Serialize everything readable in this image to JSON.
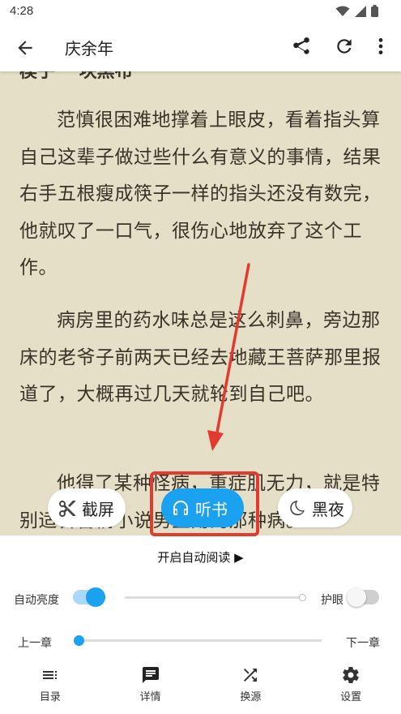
{
  "status": {
    "time": "4:28"
  },
  "appbar": {
    "title": "庆余年"
  },
  "reader": {
    "chapter_fragment": "楔子 一块黑布",
    "paragraphs": [
      "范慎很困难地撑着上眼皮，看着指头算自己这辈子做过些什么有意义的事情，结果右手五根瘦成筷子一样的指头还没有数完，他就叹了一口气，很伤心地放弃了这个工作。",
      "病房里的药水味总是这么刺鼻，旁边那床的老爷子前两天已经去地藏王菩萨那里报道了，大概再过几天就轮到自己吧。",
      "他得了某种怪病，重症肌无力，就是特别适合言情小说男主角的那种病。"
    ]
  },
  "actions": {
    "screenshot_label": "截屏",
    "listen_label": "听书",
    "night_label": "黑夜"
  },
  "panel": {
    "auto_read_label": "开启自动阅读 ▶",
    "auto_brightness_label": "自动亮度",
    "eye_care_label": "护眼",
    "prev_chapter_label": "上一章",
    "next_chapter_label": "下一章",
    "auto_brightness_on": true,
    "eye_care_on": false,
    "brightness_level": 0,
    "chapter_progress": 0
  },
  "nav": [
    {
      "label": "目录",
      "icon": "toc-icon"
    },
    {
      "label": "详情",
      "icon": "chat-icon"
    },
    {
      "label": "换源",
      "icon": "shuffle-icon"
    },
    {
      "label": "设置",
      "icon": "gear-icon"
    }
  ],
  "colors": {
    "accent": "#1aa1f0",
    "page_bg": "#e6dfc8",
    "text": "#3a3227",
    "highlight": "#e23a2e"
  }
}
